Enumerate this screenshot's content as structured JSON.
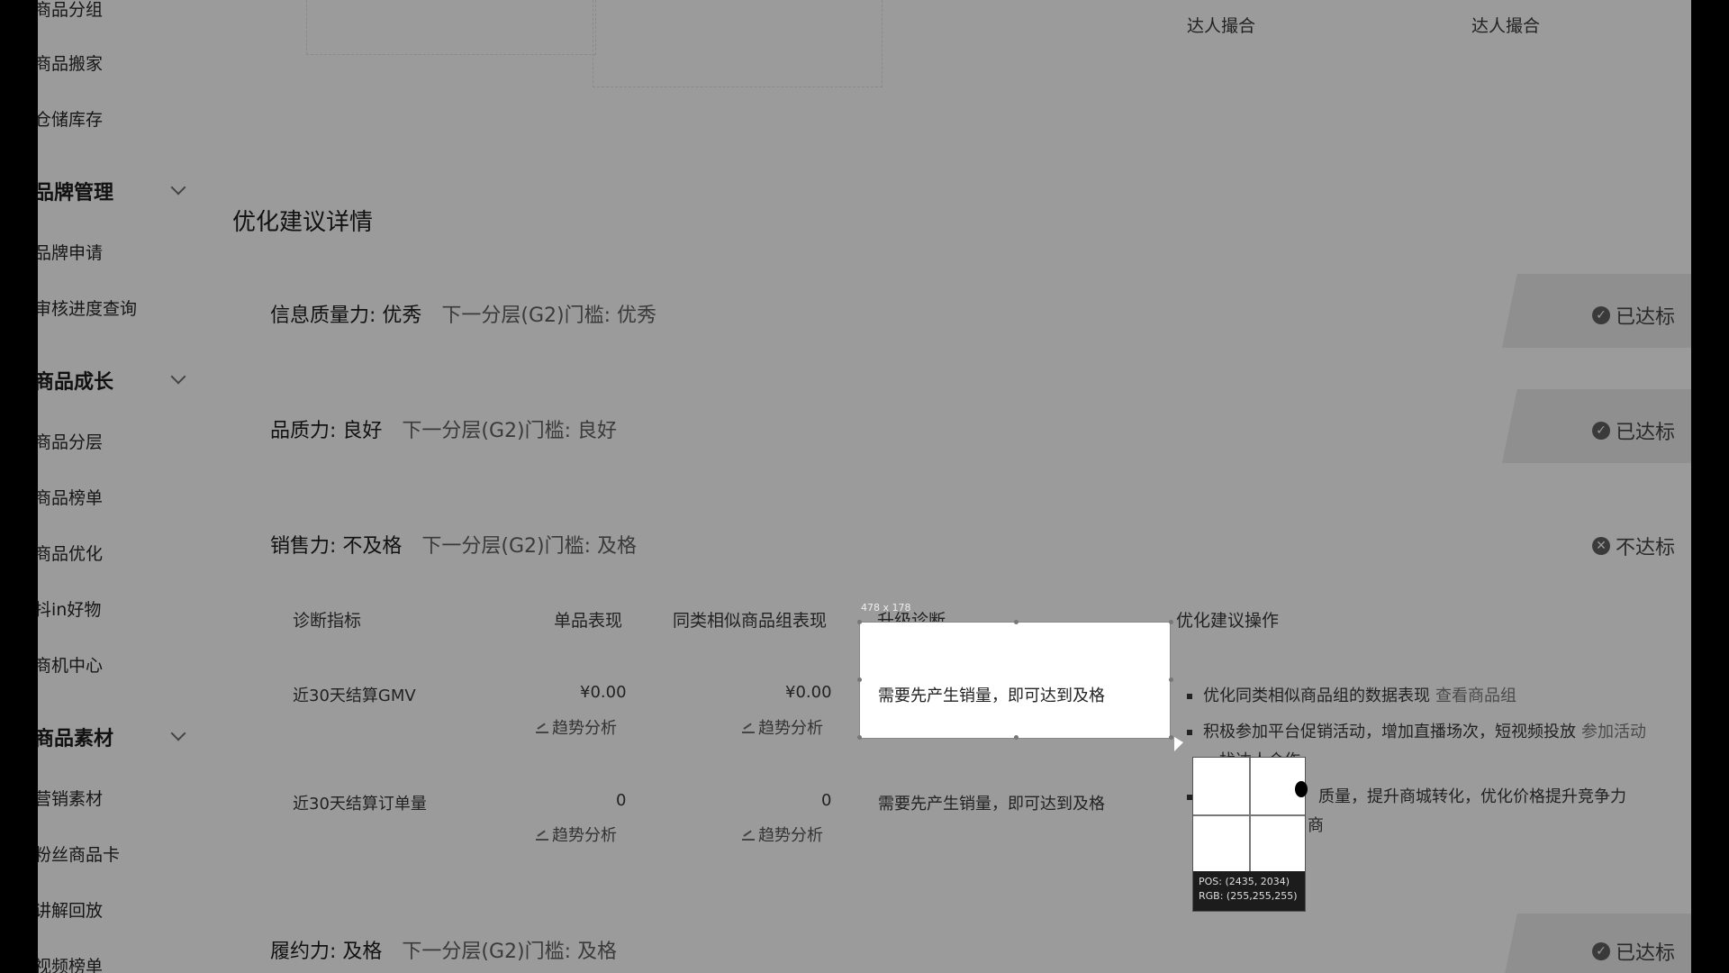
{
  "sidebar": {
    "items_top": [
      "商品分组",
      "商品搬家",
      "仓储库存"
    ],
    "brand_group": "品牌管理",
    "brand_items": [
      "品牌申请",
      "审核进度查询"
    ],
    "growth_group": "商品成长",
    "growth_items": [
      "商品分层",
      "商品榜单",
      "商品优化",
      "抖in好物",
      "商机中心"
    ],
    "material_group": "商品素材",
    "material_items": [
      "营销素材",
      "粉丝商品卡",
      "讲解回放",
      "视频榜单"
    ]
  },
  "header": {
    "col1": "达人撮合",
    "col2": "达人撮合"
  },
  "section_title": "优化建议详情",
  "metrics": [
    {
      "name": "信息质量力: 优秀",
      "threshold": "下一分层(G2)门槛: 优秀",
      "status": "已达标",
      "status_icon": "check-icon"
    },
    {
      "name": "品质力: 良好",
      "threshold": "下一分层(G2)门槛: 良好",
      "status": "已达标",
      "status_icon": "check-icon"
    },
    {
      "name": "销售力: 不及格",
      "threshold": "下一分层(G2)门槛: 及格",
      "status": "不达标",
      "status_icon": "cross-icon"
    },
    {
      "name": "履约力: 及格",
      "threshold": "下一分层(G2)门槛: 及格",
      "status": "已达标",
      "status_icon": "check-icon"
    }
  ],
  "table": {
    "headers": [
      "诊断指标",
      "单品表现",
      "同类相似商品组表现",
      "升级诊断",
      "优化建议操作"
    ],
    "rows": [
      {
        "indicator": "近30天结算GMV",
        "single": "¥0.00",
        "group": "¥0.00",
        "diagnosis": "需要先产生销量，即可达到及格",
        "trend": "趋势分析"
      },
      {
        "indicator": "近30天结算订单量",
        "single": "0",
        "group": "0",
        "diagnosis": "需要先产生销量，即可达到及格",
        "trend": "趋势分析"
      }
    ],
    "suggestions": [
      {
        "text": "优化同类相似商品组的数据表现",
        "link": "查看商品组"
      },
      {
        "text": "积极参加平台促销活动，增加直播场次，短视频投放",
        "link": "参加活动"
      },
      {
        "text": "找达人合作",
        "link": ""
      },
      {
        "text": "质量，提升商城转化，优化价格提升竞争力",
        "link": ""
      },
      {
        "text": "商",
        "link": ""
      }
    ]
  },
  "overlay": {
    "size_tag": "478 x 178",
    "pos": "POS: (2435, 2034)",
    "rgb": "RGB: (255,255,255)"
  }
}
